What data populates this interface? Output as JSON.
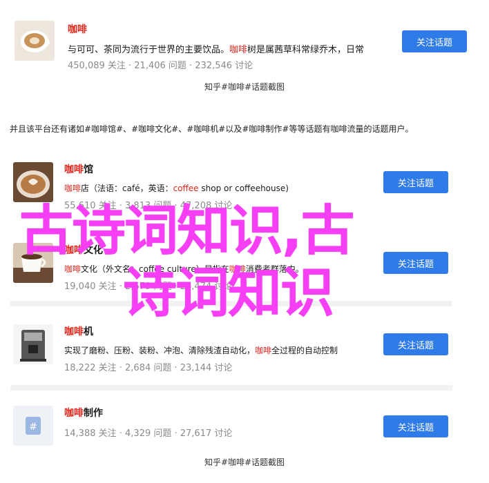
{
  "topics": [
    {
      "title_hl": "咖啡",
      "title_rest": "",
      "desc_parts": [
        "与可可、茶同为流行于世界的主要饮品。",
        "咖啡",
        "树是属茜草科常绿乔木，日常"
      ],
      "meta": "450,089 关注 · 21,406 问题 · 232,546 讨论",
      "button": "关注话题",
      "thumb_icon": "latte-cup-image"
    },
    {
      "title_hl": "咖啡",
      "title_rest": "馆",
      "desc_parts": [
        "",
        "咖啡",
        "店（法语：café，英语：",
        "coffee",
        " shop or coffeehouse)"
      ],
      "meta": "55,610 关注 · 3,813 问题 · 47,208 讨论",
      "button": "关注话题",
      "thumb_icon": "latte-art-image"
    },
    {
      "title_hl": "咖啡",
      "title_rest": "文化",
      "desc_parts": [
        "",
        "咖啡",
        "文化（外文名：coffee culture）是指在",
        "咖啡",
        "消费者群落中。"
      ],
      "meta": "19,040 关注 · 2,679 问题 · 26,474 讨论",
      "button": "关注话题",
      "thumb_icon": "coffee-cup-image"
    },
    {
      "title_hl": "咖啡",
      "title_rest": "机",
      "desc_parts": [
        "实现了磨粉、压粉、装粉、冲泡、清除残渣自动化，",
        "咖啡",
        "全过程的自动控制"
      ],
      "meta": "18,222 关注 · 2,684 问题 · 23,144 讨论",
      "button": "关注话题",
      "thumb_icon": "coffee-machine-image"
    },
    {
      "title_hl": "咖啡",
      "title_rest": "制作",
      "desc_parts": [],
      "meta": "14,388 关注 · 4,329 问题 · 27,617 讨论",
      "button": "关注话题",
      "thumb_icon": "hashtag-icon"
    }
  ],
  "captions": {
    "top": "知乎#咖啡#话题截图",
    "bottom": "知乎#咖啡#话题截图"
  },
  "paragraph": "并且该平台还有诸如#咖啡馆#、#咖啡文化#、#咖啡机#以及#咖啡制作#等等话题有咖啡流量的话题用户。",
  "overlay": {
    "line1": "古诗词知识,古",
    "line2": "诗词知识",
    "color": "#f63ef5"
  },
  "colors": {
    "accent_red": "#e1251b",
    "button_blue": "#2f7be8",
    "meta_gray": "#8a8a8a"
  }
}
